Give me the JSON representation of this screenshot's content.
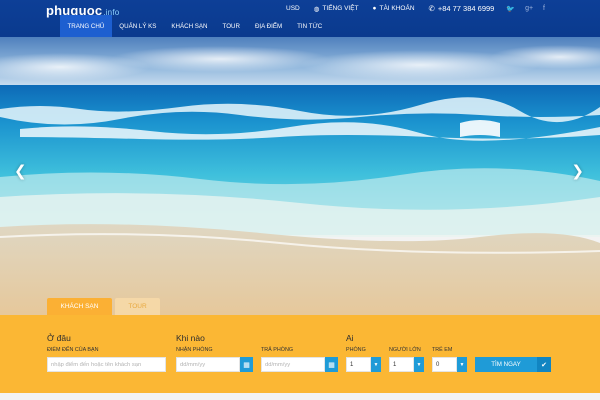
{
  "brand": {
    "name": "phuquoc",
    "suffix": ".info"
  },
  "topbar": {
    "currency": "USD",
    "language": "TIẾNG VIỆT",
    "account": "TÀI KHOẢN",
    "phone": "+84 77 384 6999",
    "social": [
      "twitter-icon",
      "google-plus-icon",
      "facebook-icon"
    ]
  },
  "nav": {
    "items": [
      {
        "label": "TRANG CHỦ",
        "active": true
      },
      {
        "label": "QUẢN LÝ KS"
      },
      {
        "label": "KHÁCH SẠN"
      },
      {
        "label": "TOUR"
      },
      {
        "label": "ĐỊA ĐIỂM"
      },
      {
        "label": "TIN TỨC"
      }
    ]
  },
  "tabs": {
    "hotel": "KHÁCH SẠN",
    "tour": "TOUR"
  },
  "search": {
    "where": {
      "title": "Ở đâu",
      "label": "ĐIỂM ĐẾN CỦA BẠN",
      "placeholder": "nhập điểm đến hoặc tên khách sạn"
    },
    "when": {
      "title": "Khi nào",
      "checkin_label": "NHẬN PHÒNG",
      "checkout_label": "TRẢ PHÒNG",
      "date_placeholder": "dd/mm/yy"
    },
    "who": {
      "title": "Ai",
      "rooms_label": "PHÒNG",
      "rooms_value": "1",
      "adults_label": "NGƯỜI LỚN",
      "adults_value": "1",
      "children_label": "TRẺ EM",
      "children_value": "0"
    },
    "submit": "TÌM NGAY"
  },
  "colors": {
    "header": "#0d3f97",
    "nav_active": "#1d5fd0",
    "search_bg": "#fbb734",
    "accent_blue": "#1f9bd7"
  }
}
